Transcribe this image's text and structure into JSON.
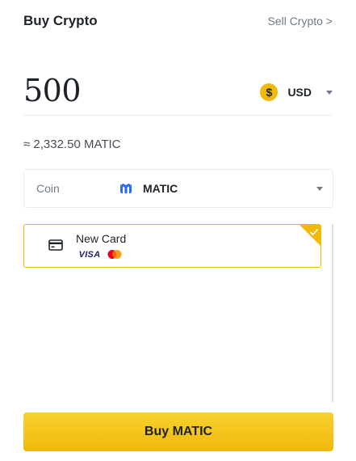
{
  "header": {
    "title": "Buy Crypto",
    "sell_link": "Sell Crypto >"
  },
  "amount": {
    "value": "500",
    "currency_symbol": "$",
    "currency": "USD"
  },
  "estimate": "≈ 2,332.50 MATIC",
  "coin": {
    "label": "Coin",
    "value": "MATIC"
  },
  "payment_methods": [
    {
      "title": "New Card",
      "brands": [
        "VISA",
        "Mastercard"
      ],
      "selected": true
    }
  ],
  "buy_button": {
    "label": "Buy MATIC"
  },
  "colors": {
    "accent": "#F0B90B",
    "text": "#1E2329",
    "muted": "#707A8A",
    "matic": "#2B6DEF"
  },
  "icons": {
    "currency": "dollar-coin-icon",
    "coin": "matic-icon",
    "card": "card-icon"
  }
}
